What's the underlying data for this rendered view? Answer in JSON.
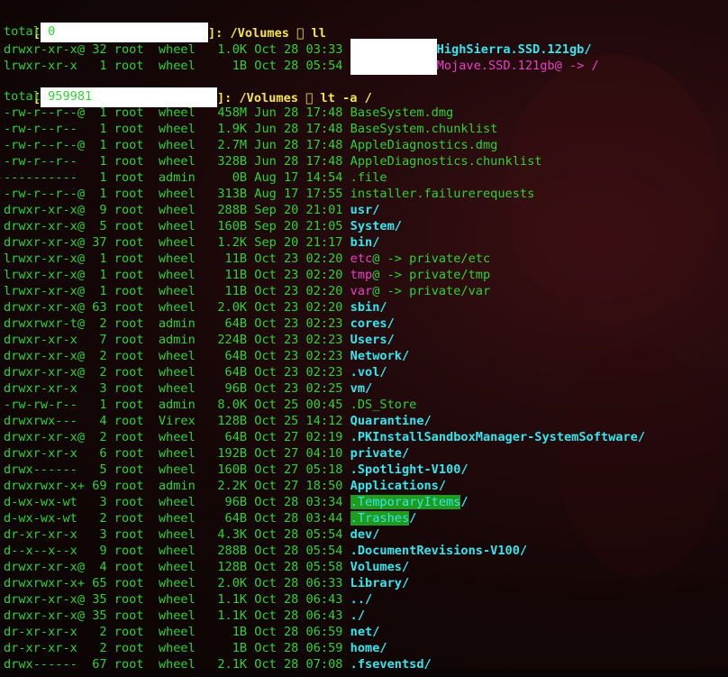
{
  "theme": {
    "green": "#2fd32f",
    "cyan": "#34e6ee",
    "magenta": "#e83fc9",
    "yellow": "#f5e64a",
    "highlight": "#1f9c1c"
  },
  "prompt1": {
    "open": "[",
    "icon": "apple-icon",
    "close": "]:",
    "path": "/Volumes",
    "cmd": "ll"
  },
  "out1_total": "total 0",
  "vol_rows": [
    {
      "perms": "drwxr-xr-x@",
      "links": "32",
      "owner": "root",
      "group": "wheel",
      "size": "1.0K",
      "date": "Oct 28 03:33",
      "name": "HighSierra.SSD.121gb/",
      "style": "cyan"
    },
    {
      "perms": "lrwxr-xr-x ",
      "links": " 1",
      "owner": "root",
      "group": "wheel",
      "size": "  1B",
      "date": "Oct 28 05:54",
      "name": "Mojave.SSD.121gb@ -> /",
      "style": "mag"
    }
  ],
  "prompt2": {
    "open": "[",
    "close": "]:",
    "path": "/Volumes",
    "cmd": "lt -a /"
  },
  "out2_total": "total 959981",
  "rows": [
    {
      "perms": "-rw-r--r--@",
      "links": " 1",
      "owner": "root",
      "group": "wheel",
      "size": "458M",
      "date": "Jun 28 17:48",
      "name": "BaseSystem.dmg",
      "style": "plain"
    },
    {
      "perms": "-rw-r--r-- ",
      "links": " 1",
      "owner": "root",
      "group": "wheel",
      "size": "1.9K",
      "date": "Jun 28 17:48",
      "name": "BaseSystem.chunklist",
      "style": "plain"
    },
    {
      "perms": "-rw-r--r--@",
      "links": " 1",
      "owner": "root",
      "group": "wheel",
      "size": "2.7M",
      "date": "Jun 28 17:48",
      "name": "AppleDiagnostics.dmg",
      "style": "plain"
    },
    {
      "perms": "-rw-r--r-- ",
      "links": " 1",
      "owner": "root",
      "group": "wheel",
      "size": "328B",
      "date": "Jun 28 17:48",
      "name": "AppleDiagnostics.chunklist",
      "style": "plain"
    },
    {
      "perms": "---------- ",
      "links": " 1",
      "owner": "root",
      "group": "admin",
      "size": "  0B",
      "date": "Aug 17 14:54",
      "name": ".file",
      "style": "plain"
    },
    {
      "perms": "-rw-r--r--@",
      "links": " 1",
      "owner": "root",
      "group": "wheel",
      "size": "313B",
      "date": "Aug 17 17:55",
      "name": "installer.failurerequests",
      "style": "plain"
    },
    {
      "perms": "drwxr-xr-x@",
      "links": " 9",
      "owner": "root",
      "group": "wheel",
      "size": "288B",
      "date": "Sep 20 21:01",
      "name": "usr/",
      "style": "cyan"
    },
    {
      "perms": "drwxr-xr-x@",
      "links": " 5",
      "owner": "root",
      "group": "wheel",
      "size": "160B",
      "date": "Sep 20 21:05",
      "name": "System/",
      "style": "cyan"
    },
    {
      "perms": "drwxr-xr-x@",
      "links": "37",
      "owner": "root",
      "group": "wheel",
      "size": "1.2K",
      "date": "Sep 20 21:17",
      "name": "bin/",
      "style": "cyan"
    },
    {
      "perms": "lrwxr-xr-x@",
      "links": " 1",
      "owner": "root",
      "group": "wheel",
      "size": " 11B",
      "date": "Oct 23 02:20",
      "name": "etc@ -> private/etc",
      "style": "link"
    },
    {
      "perms": "lrwxr-xr-x@",
      "links": " 1",
      "owner": "root",
      "group": "wheel",
      "size": " 11B",
      "date": "Oct 23 02:20",
      "name": "tmp@ -> private/tmp",
      "style": "link"
    },
    {
      "perms": "lrwxr-xr-x@",
      "links": " 1",
      "owner": "root",
      "group": "wheel",
      "size": " 11B",
      "date": "Oct 23 02:20",
      "name": "var@ -> private/var",
      "style": "link"
    },
    {
      "perms": "drwxr-xr-x@",
      "links": "63",
      "owner": "root",
      "group": "wheel",
      "size": "2.0K",
      "date": "Oct 23 02:20",
      "name": "sbin/",
      "style": "cyan"
    },
    {
      "perms": "drwxrwxr-t@",
      "links": " 2",
      "owner": "root",
      "group": "admin",
      "size": " 64B",
      "date": "Oct 23 02:23",
      "name": "cores/",
      "style": "cyan"
    },
    {
      "perms": "drwxr-xr-x ",
      "links": " 7",
      "owner": "root",
      "group": "admin",
      "size": "224B",
      "date": "Oct 23 02:23",
      "name": "Users/",
      "style": "cyan"
    },
    {
      "perms": "drwxr-xr-x@",
      "links": " 2",
      "owner": "root",
      "group": "wheel",
      "size": " 64B",
      "date": "Oct 23 02:23",
      "name": "Network/",
      "style": "cyan"
    },
    {
      "perms": "drwxr-xr-x@",
      "links": " 2",
      "owner": "root",
      "group": "wheel",
      "size": " 64B",
      "date": "Oct 23 02:23",
      "name": ".vol/",
      "style": "cyan"
    },
    {
      "perms": "drwxr-xr-x ",
      "links": " 3",
      "owner": "root",
      "group": "wheel",
      "size": " 96B",
      "date": "Oct 23 02:25",
      "name": "vm/",
      "style": "cyan"
    },
    {
      "perms": "-rw-rw-r-- ",
      "links": " 1",
      "owner": "root",
      "group": "admin",
      "size": "8.0K",
      "date": "Oct 25 00:45",
      "name": ".DS_Store",
      "style": "plain"
    },
    {
      "perms": "drwxrwx--- ",
      "links": " 4",
      "owner": "root",
      "group": "Virex",
      "size": "128B",
      "date": "Oct 25 14:12",
      "name": "Quarantine/",
      "style": "cyan"
    },
    {
      "perms": "drwxr-xr-x@",
      "links": " 2",
      "owner": "root",
      "group": "wheel",
      "size": " 64B",
      "date": "Oct 27 02:19",
      "name": ".PKInstallSandboxManager-SystemSoftware/",
      "style": "cyan"
    },
    {
      "perms": "drwxr-xr-x ",
      "links": " 6",
      "owner": "root",
      "group": "wheel",
      "size": "192B",
      "date": "Oct 27 04:10",
      "name": "private/",
      "style": "cyan"
    },
    {
      "perms": "drwx------ ",
      "links": " 5",
      "owner": "root",
      "group": "wheel",
      "size": "160B",
      "date": "Oct 27 05:18",
      "name": ".Spotlight-V100/",
      "style": "cyan"
    },
    {
      "perms": "drwxrwxr-x+",
      "links": "69",
      "owner": "root",
      "group": "admin",
      "size": "2.2K",
      "date": "Oct 27 18:50",
      "name": "Applications/",
      "style": "cyan"
    },
    {
      "perms": "d-wx-wx-wt ",
      "links": " 3",
      "owner": "root",
      "group": "wheel",
      "size": " 96B",
      "date": "Oct 28 03:34",
      "name": ".TemporaryItems/",
      "style": "hl"
    },
    {
      "perms": "d-wx-wx-wt ",
      "links": " 2",
      "owner": "root",
      "group": "wheel",
      "size": " 64B",
      "date": "Oct 28 03:44",
      "name": ".Trashes/",
      "style": "hl"
    },
    {
      "perms": "dr-xr-xr-x ",
      "links": " 3",
      "owner": "root",
      "group": "wheel",
      "size": "4.3K",
      "date": "Oct 28 05:54",
      "name": "dev/",
      "style": "cyan"
    },
    {
      "perms": "d--x--x--x ",
      "links": " 9",
      "owner": "root",
      "group": "wheel",
      "size": "288B",
      "date": "Oct 28 05:54",
      "name": ".DocumentRevisions-V100/",
      "style": "cyan"
    },
    {
      "perms": "drwxr-xr-x@",
      "links": " 4",
      "owner": "root",
      "group": "wheel",
      "size": "128B",
      "date": "Oct 28 05:58",
      "name": "Volumes/",
      "style": "cyan"
    },
    {
      "perms": "drwxrwxr-x+",
      "links": "65",
      "owner": "root",
      "group": "wheel",
      "size": "2.0K",
      "date": "Oct 28 06:33",
      "name": "Library/",
      "style": "cyan"
    },
    {
      "perms": "drwxr-xr-x@",
      "links": "35",
      "owner": "root",
      "group": "wheel",
      "size": "1.1K",
      "date": "Oct 28 06:43",
      "name": "../",
      "style": "cyan"
    },
    {
      "perms": "drwxr-xr-x@",
      "links": "35",
      "owner": "root",
      "group": "wheel",
      "size": "1.1K",
      "date": "Oct 28 06:43",
      "name": "./",
      "style": "cyan"
    },
    {
      "perms": "dr-xr-xr-x ",
      "links": " 2",
      "owner": "root",
      "group": "wheel",
      "size": "  1B",
      "date": "Oct 28 06:59",
      "name": "net/",
      "style": "cyan"
    },
    {
      "perms": "dr-xr-xr-x ",
      "links": " 2",
      "owner": "root",
      "group": "wheel",
      "size": "  1B",
      "date": "Oct 28 06:59",
      "name": "home/",
      "style": "cyan"
    },
    {
      "perms": "drwx------ ",
      "links": "67",
      "owner": "root",
      "group": "wheel",
      "size": "2.1K",
      "date": "Oct 28 07:08",
      "name": ".fseventsd/",
      "style": "cyan"
    }
  ]
}
